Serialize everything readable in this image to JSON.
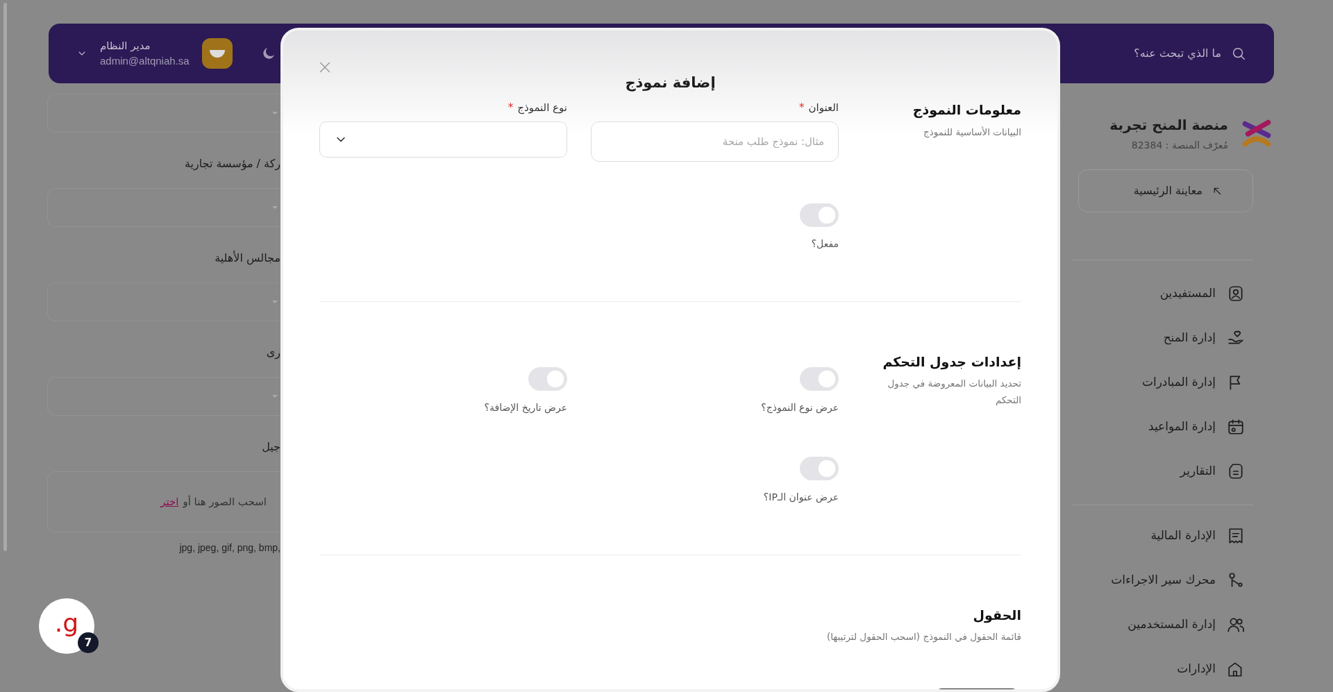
{
  "top_bar": {
    "search": {
      "placeholder": "ما الذي تبحث عنه؟"
    },
    "user": {
      "name": "مدير النظام",
      "email": "admin@altqniah.sa"
    }
  },
  "sidebar": {
    "platform_name": "منصة المنح تجربة",
    "platform_id": "مُعرّف المنصة : 82384",
    "preview_button": "معاينة الرئيسية",
    "item_groups": [
      [
        {
          "label": "المستفيدين"
        },
        {
          "label": "إدارة المنح"
        },
        {
          "label": "إدارة المبادرات"
        },
        {
          "label": "إدارة المواعيد"
        },
        {
          "label": "التقارير"
        }
      ],
      [
        {
          "label": "الإدارة المالية"
        },
        {
          "label": "محرك سير الاجراءات"
        },
        {
          "label": "إدارة المستخدمين"
        },
        {
          "label": "الإدارات"
        }
      ]
    ]
  },
  "background_form": {
    "fields": [
      {
        "kind": "select"
      },
      {
        "kind": "select",
        "label": "ركة / مؤسسة تجارية"
      },
      {
        "kind": "select",
        "label": "مجالس الأهلية"
      },
      {
        "kind": "select",
        "label": "رى"
      },
      {
        "kind": "upload",
        "label": "جيل",
        "prompt": "اسحب الصور هنا أو",
        "link": "اختر",
        "hint": "jpg, jpeg, gif, png, bmp,"
      }
    ]
  },
  "modal": {
    "title": "إضافة نموذج",
    "sections": [
      {
        "title": "معلومات النموذج",
        "description": "البيانات الأساسية للنموذج",
        "fields": [
          {
            "kind": "text",
            "label": "العنوان",
            "required_mark": "*",
            "placeholder": "مثال: نموذج طلب منحة"
          },
          {
            "kind": "select",
            "label": "نوع النموذج",
            "required_mark": "*"
          },
          {
            "kind": "toggle",
            "label": "مفعل؟",
            "on": false
          }
        ]
      },
      {
        "title": "إعدادات جدول التحكم",
        "description": "تحديد البيانات المعروضة في جدول التحكم",
        "fields": [
          {
            "kind": "toggle",
            "label": "عرض نوع النموذج؟",
            "on": false
          },
          {
            "kind": "toggle",
            "label": "عرض تاريخ الإضافة؟",
            "on": false
          },
          {
            "kind": "toggle",
            "label": "عرض عنوان الـIP؟",
            "on": false
          }
        ]
      },
      {
        "title": "الحقول",
        "description": "قائمة الحقول في النموذج (اسحب الحقول لترتيبها)"
      }
    ]
  },
  "help_widget": {
    "letter": "g.",
    "badge": "7"
  }
}
